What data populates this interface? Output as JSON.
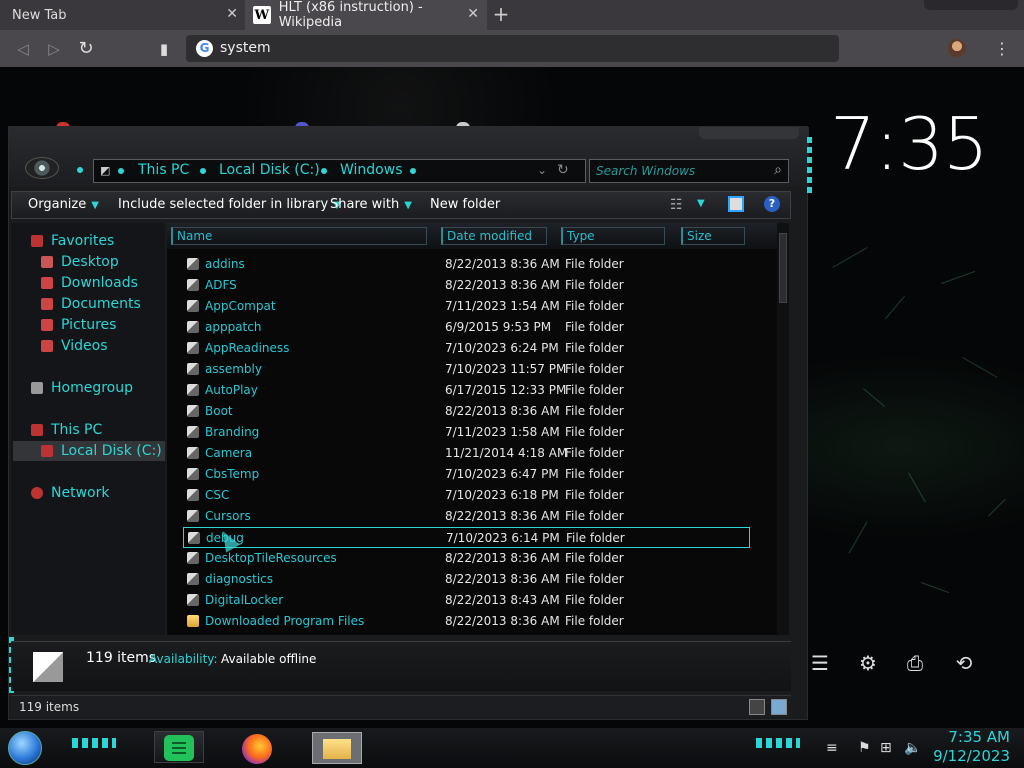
{
  "browser": {
    "tabs": [
      {
        "label": "New Tab"
      },
      {
        "label": "HLT (x86 instruction) - Wikipedia",
        "favicon": "W"
      }
    ],
    "new_tab_symbol": "+",
    "omnibox": {
      "value": "system"
    },
    "icons": {
      "back": "◁",
      "forward": "▷",
      "reload": "↻",
      "bookmark": "▮",
      "menu": "⋮",
      "close": "✕"
    }
  },
  "desktop": {
    "clock": "7:35"
  },
  "explorer": {
    "breadcrumb": [
      "This PC",
      "Local Disk (C:)",
      "Windows"
    ],
    "search_placeholder": "Search Windows",
    "commands": [
      {
        "label": "Organize"
      },
      {
        "label": "Include selected folder in library"
      },
      {
        "label": "Share with"
      },
      {
        "label": "New folder"
      }
    ],
    "nav": {
      "favorites": "Favorites",
      "desktop": "Desktop",
      "downloads": "Downloads",
      "documents": "Documents",
      "pictures": "Pictures",
      "videos": "Videos",
      "homegroup": "Homegroup",
      "thispc": "This PC",
      "localdisk": "Local Disk (C:)",
      "network": "Network"
    },
    "columns": [
      "Name",
      "Date modified",
      "Type",
      "Size"
    ],
    "rows": [
      {
        "name": "addins",
        "date": "8/22/2013 8:36 AM",
        "type": "File folder"
      },
      {
        "name": "ADFS",
        "date": "8/22/2013 8:36 AM",
        "type": "File folder"
      },
      {
        "name": "AppCompat",
        "date": "7/11/2023 1:54 AM",
        "type": "File folder"
      },
      {
        "name": "apppatch",
        "date": "6/9/2015 9:53 PM",
        "type": "File folder"
      },
      {
        "name": "AppReadiness",
        "date": "7/10/2023 6:24 PM",
        "type": "File folder"
      },
      {
        "name": "assembly",
        "date": "7/10/2023 11:57 PM",
        "type": "File folder"
      },
      {
        "name": "AutoPlay",
        "date": "6/17/2015 12:33 PM",
        "type": "File folder"
      },
      {
        "name": "Boot",
        "date": "8/22/2013 8:36 AM",
        "type": "File folder"
      },
      {
        "name": "Branding",
        "date": "7/11/2023 1:58 AM",
        "type": "File folder"
      },
      {
        "name": "Camera",
        "date": "11/21/2014 4:18 AM",
        "type": "File folder"
      },
      {
        "name": "CbsTemp",
        "date": "7/10/2023 6:47 PM",
        "type": "File folder"
      },
      {
        "name": "CSC",
        "date": "7/10/2023 6:18 PM",
        "type": "File folder"
      },
      {
        "name": "Cursors",
        "date": "8/22/2013 8:36 AM",
        "type": "File folder"
      },
      {
        "name": "debug",
        "date": "7/10/2023 6:14 PM",
        "type": "File folder"
      },
      {
        "name": "DesktopTileResources",
        "date": "8/22/2013 8:36 AM",
        "type": "File folder"
      },
      {
        "name": "diagnostics",
        "date": "8/22/2013 8:36 AM",
        "type": "File folder"
      },
      {
        "name": "DigitalLocker",
        "date": "8/22/2013 8:43 AM",
        "type": "File folder"
      },
      {
        "name": "Downloaded Program Files",
        "date": "8/22/2013 8:36 AM",
        "type": "File folder"
      }
    ],
    "details": {
      "count": "119 items",
      "availability_label": "Availability:",
      "availability_value": "Available offline"
    },
    "status": "119 items"
  },
  "taskbar": {
    "time": "7:35 AM",
    "date": "9/12/2023"
  }
}
